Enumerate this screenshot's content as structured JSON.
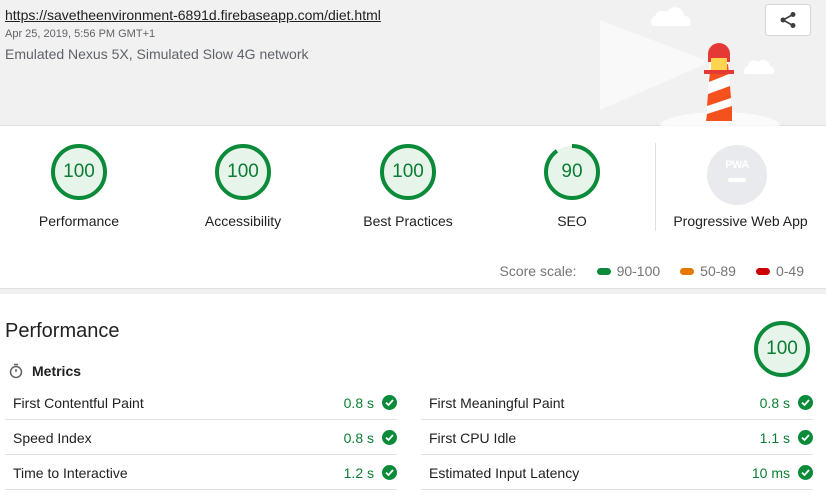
{
  "header": {
    "url": "https://savetheenvironment-6891d.firebaseapp.com/diet.html",
    "timestamp": "Apr 25, 2019, 5:56 PM GMT+1",
    "environment": "Emulated Nexus 5X, Simulated Slow 4G network",
    "share_icon": "share-icon"
  },
  "gauges": [
    {
      "score": "100",
      "label": "Performance",
      "fraction": 1.0
    },
    {
      "score": "100",
      "label": "Accessibility",
      "fraction": 1.0
    },
    {
      "score": "100",
      "label": "Best Practices",
      "fraction": 1.0
    },
    {
      "score": "90",
      "label": "SEO",
      "fraction": 0.9
    }
  ],
  "pwa": {
    "badge": "PWA",
    "label": "Progressive Web App"
  },
  "legend": {
    "title": "Score scale:",
    "items": [
      {
        "label": "90-100",
        "color": "#0b8a3a"
      },
      {
        "label": "50-89",
        "color": "#e67700"
      },
      {
        "label": "0-49",
        "color": "#cc0000"
      }
    ]
  },
  "performance": {
    "title": "Performance",
    "score": "100",
    "metrics_title": "Metrics",
    "metrics_left": [
      {
        "name": "First Contentful Paint",
        "value": "0.8 s"
      },
      {
        "name": "Speed Index",
        "value": "0.8 s"
      },
      {
        "name": "Time to Interactive",
        "value": "1.2 s"
      }
    ],
    "metrics_right": [
      {
        "name": "First Meaningful Paint",
        "value": "0.8 s"
      },
      {
        "name": "First CPU Idle",
        "value": "1.1 s"
      },
      {
        "name": "Estimated Input Latency",
        "value": "10 ms"
      }
    ]
  },
  "colors": {
    "pass": "#0b8a3a",
    "pass_text": "#0b7d34",
    "background": "#f1f1f1"
  }
}
